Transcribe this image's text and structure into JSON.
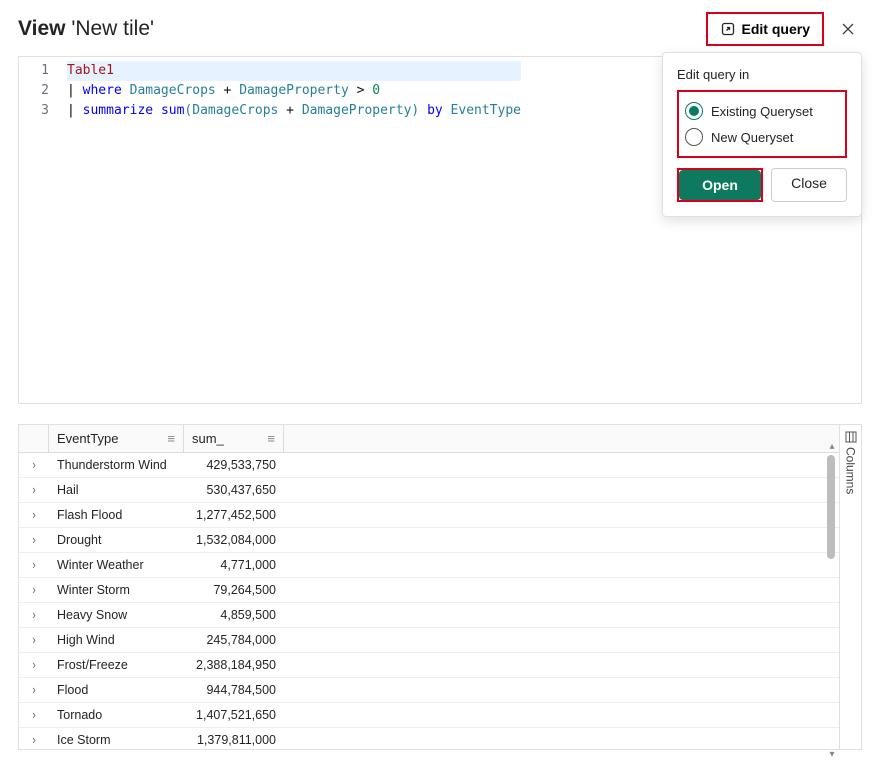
{
  "header": {
    "title_prefix": "View",
    "title_name": "'New tile'",
    "edit_query_label": "Edit query"
  },
  "code": {
    "lines": [
      {
        "n": "1",
        "tokens": [
          [
            "tbl",
            "Table1"
          ]
        ]
      },
      {
        "n": "2",
        "tokens": [
          [
            "pipe",
            "| "
          ],
          [
            "kw",
            "where "
          ],
          [
            "col",
            "DamageCrops "
          ],
          [
            "plain",
            "+ "
          ],
          [
            "col",
            "DamageProperty "
          ],
          [
            "plain",
            "> "
          ],
          [
            "num",
            "0"
          ]
        ]
      },
      {
        "n": "3",
        "tokens": [
          [
            "pipe",
            "| "
          ],
          [
            "kw",
            "summarize "
          ],
          [
            "fn",
            "sum"
          ],
          [
            "paren",
            "("
          ],
          [
            "col",
            "DamageCrops "
          ],
          [
            "plain",
            "+ "
          ],
          [
            "col",
            "DamageProperty"
          ],
          [
            "paren",
            ") "
          ],
          [
            "kw",
            "by "
          ],
          [
            "col",
            "EventType"
          ]
        ]
      }
    ]
  },
  "popover": {
    "title": "Edit query in",
    "option_existing": "Existing Queryset",
    "option_new": "New Queryset",
    "open_label": "Open",
    "close_label": "Close"
  },
  "grid": {
    "col_event": "EventType",
    "col_sum": "sum_",
    "rows": [
      {
        "event": "Thunderstorm Wind",
        "sum": "429,533,750"
      },
      {
        "event": "Hail",
        "sum": "530,437,650"
      },
      {
        "event": "Flash Flood",
        "sum": "1,277,452,500"
      },
      {
        "event": "Drought",
        "sum": "1,532,084,000"
      },
      {
        "event": "Winter Weather",
        "sum": "4,771,000"
      },
      {
        "event": "Winter Storm",
        "sum": "79,264,500"
      },
      {
        "event": "Heavy Snow",
        "sum": "4,859,500"
      },
      {
        "event": "High Wind",
        "sum": "245,784,000"
      },
      {
        "event": "Frost/Freeze",
        "sum": "2,388,184,950"
      },
      {
        "event": "Flood",
        "sum": "944,784,500"
      },
      {
        "event": "Tornado",
        "sum": "1,407,521,650"
      },
      {
        "event": "Ice Storm",
        "sum": "1,379,811,000"
      }
    ]
  },
  "columns_tab": {
    "label": "Columns"
  }
}
